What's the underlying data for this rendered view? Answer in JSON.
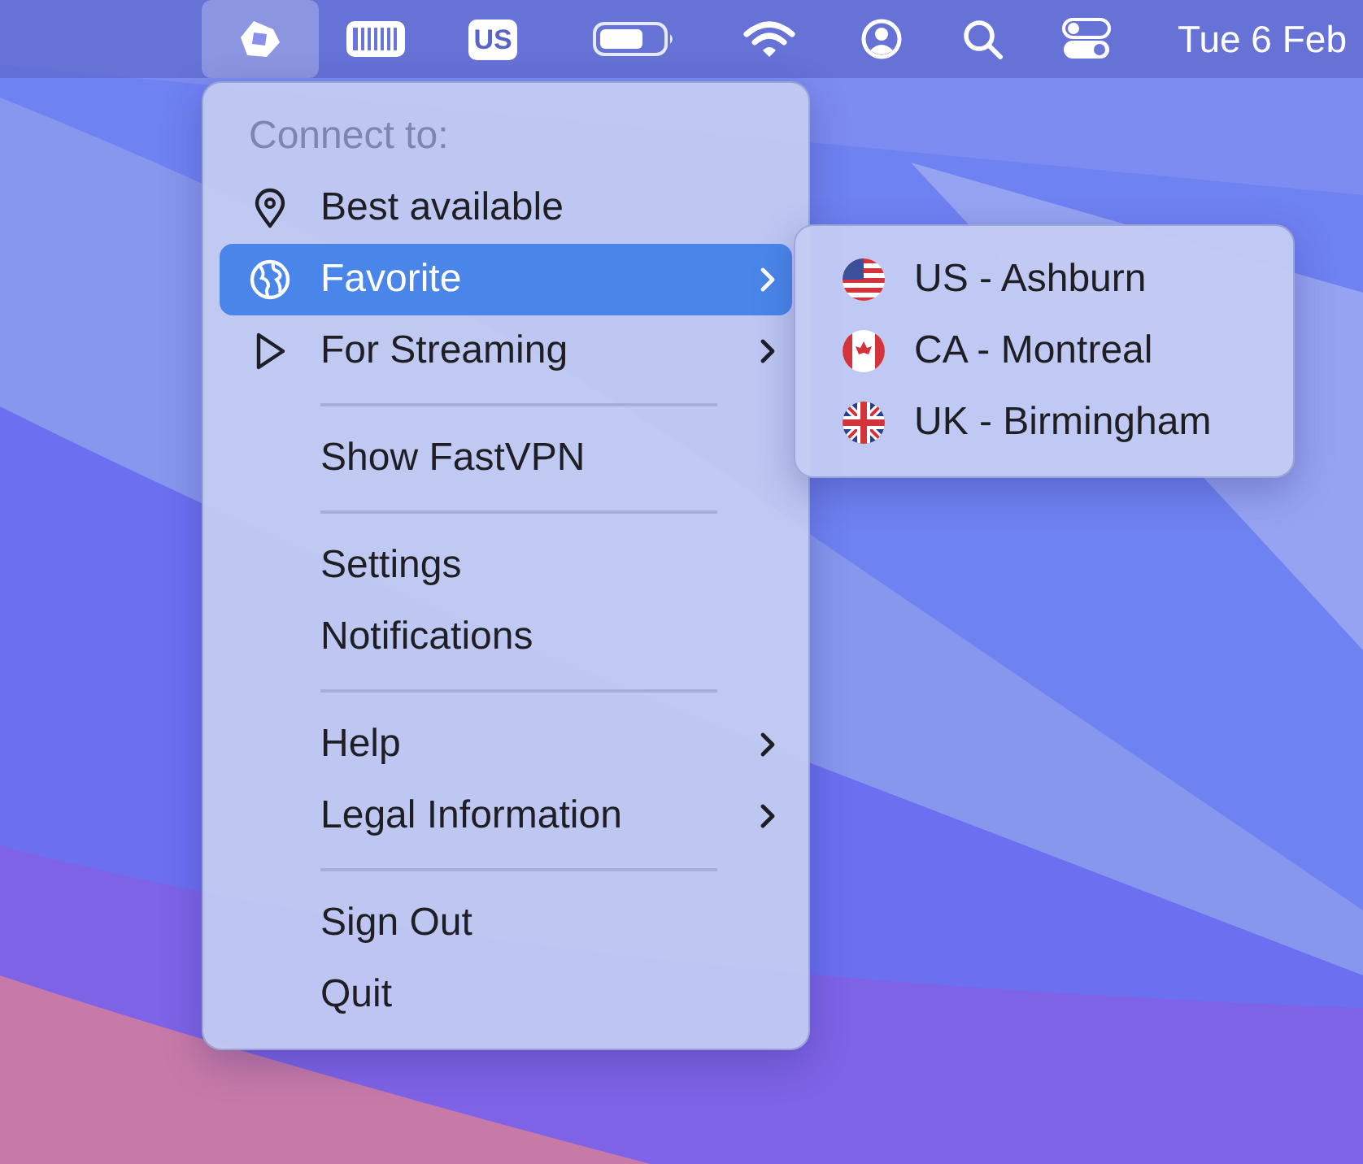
{
  "menu_bar": {
    "items": [
      {
        "kind": "app",
        "selected": true
      },
      {
        "kind": "keyboard",
        "selected": false
      },
      {
        "kind": "input_source",
        "label": "US",
        "selected": false
      },
      {
        "kind": "battery",
        "selected": false
      },
      {
        "kind": "wifi",
        "selected": false
      },
      {
        "kind": "user",
        "selected": false
      },
      {
        "kind": "search",
        "selected": false
      },
      {
        "kind": "control",
        "selected": false
      }
    ],
    "clock": "Tue 6 Feb"
  },
  "menu": {
    "header": "Connect to:",
    "sections": [
      [
        {
          "label": "Best available",
          "kind": "pin",
          "submenu": false,
          "selected": false
        },
        {
          "label": "Favorite",
          "kind": "globe",
          "submenu": true,
          "selected": true
        },
        {
          "label": "For Streaming",
          "kind": "play",
          "submenu": true,
          "selected": false
        }
      ],
      [
        {
          "label": "Show FastVPN",
          "submenu": false,
          "selected": false
        }
      ],
      [
        {
          "label": "Settings",
          "submenu": false,
          "selected": false
        },
        {
          "label": "Notifications",
          "submenu": false,
          "selected": false
        }
      ],
      [
        {
          "label": "Help",
          "submenu": true,
          "selected": false
        },
        {
          "label": "Legal Information",
          "submenu": true,
          "selected": false
        }
      ],
      [
        {
          "label": "Sign Out",
          "submenu": false,
          "selected": false
        },
        {
          "label": "Quit",
          "submenu": false,
          "selected": false
        }
      ]
    ]
  },
  "submenu": {
    "items": [
      {
        "label": "US - Ashburn",
        "kind": "us"
      },
      {
        "label": "CA - Montreal",
        "kind": "ca"
      },
      {
        "label": "UK - Birmingham",
        "kind": "uk"
      }
    ]
  }
}
